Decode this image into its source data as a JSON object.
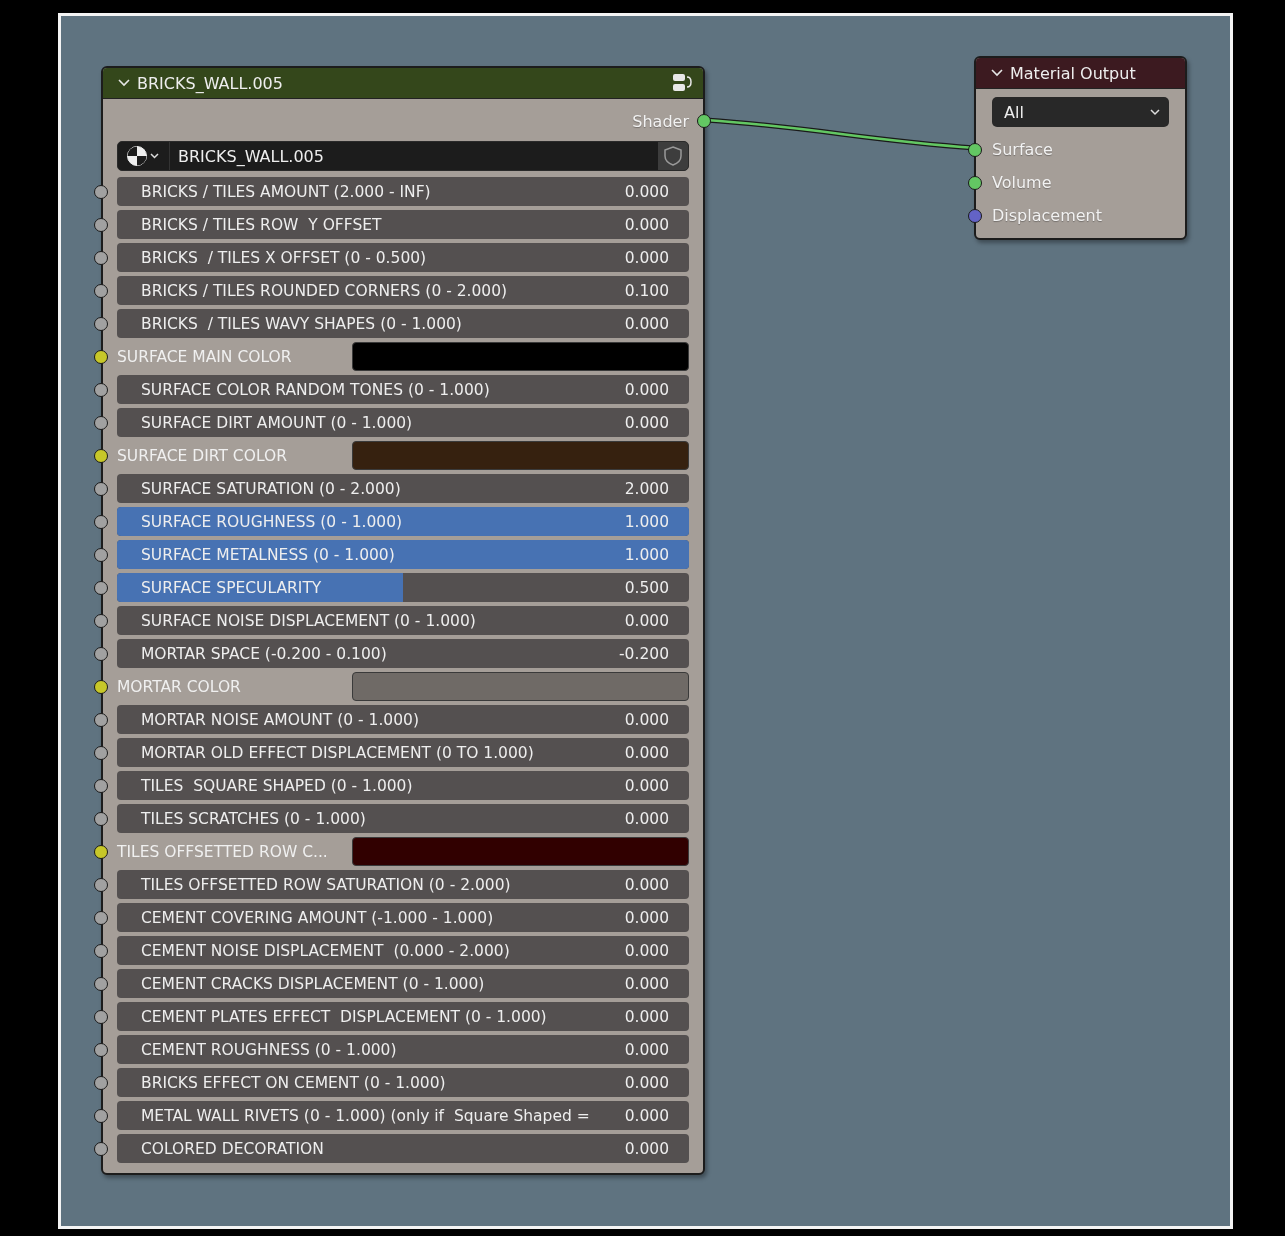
{
  "group_node": {
    "title": "BRICKS_WALL.005",
    "output": {
      "label": "Shader",
      "color": "#63c763"
    },
    "material": "BRICKS_WALL.005",
    "inputs": [
      {
        "kind": "number",
        "label": "BRICKS / TILES AMOUNT (2.000 - INF)",
        "value": "0.000"
      },
      {
        "kind": "number",
        "label": "BRICKS / TILES ROW  Y OFFSET",
        "value": "0.000"
      },
      {
        "kind": "number",
        "label": "BRICKS  / TILES X OFFSET (0 - 0.500)",
        "value": "0.000"
      },
      {
        "kind": "number",
        "label": "BRICKS / TILES ROUNDED CORNERS (0 - 2.000)",
        "value": "0.100"
      },
      {
        "kind": "number",
        "label": "BRICKS  / TILES WAVY SHAPES (0 - 1.000)",
        "value": "0.000"
      },
      {
        "kind": "color",
        "label": "SURFACE MAIN COLOR",
        "color": "#000000"
      },
      {
        "kind": "number",
        "label": "SURFACE COLOR RANDOM TONES (0 - 1.000)",
        "value": "0.000"
      },
      {
        "kind": "number",
        "label": "SURFACE DIRT AMOUNT (0 - 1.000)",
        "value": "0.000"
      },
      {
        "kind": "color",
        "label": "SURFACE DIRT COLOR",
        "color": "#36210f"
      },
      {
        "kind": "number",
        "label": "SURFACE SATURATION (0 - 2.000)",
        "value": "2.000"
      },
      {
        "kind": "slider",
        "label": "SURFACE ROUGHNESS (0 - 1.000)",
        "value": "1.000",
        "level": 1
      },
      {
        "kind": "slider",
        "label": "SURFACE METALNESS (0 - 1.000)",
        "value": "1.000",
        "level": 1
      },
      {
        "kind": "slider",
        "label": "SURFACE SPECULARITY",
        "value": "0.500",
        "level": 0.5
      },
      {
        "kind": "number",
        "label": "SURFACE NOISE DISPLACEMENT (0 - 1.000)",
        "value": "0.000"
      },
      {
        "kind": "number",
        "label": "MORTAR SPACE (-0.200 - 0.100)",
        "value": "-0.200"
      },
      {
        "kind": "color",
        "label": "MORTAR COLOR",
        "color": "#6f6a66"
      },
      {
        "kind": "number",
        "label": "MORTAR NOISE AMOUNT (0 - 1.000)",
        "value": "0.000"
      },
      {
        "kind": "number",
        "label": "MORTAR OLD EFFECT DISPLACEMENT (0 TO 1.000)",
        "value": "0.000"
      },
      {
        "kind": "number",
        "label": "TILES  SQUARE SHAPED (0 - 1.000)",
        "value": "0.000"
      },
      {
        "kind": "number",
        "label": "TILES SCRATCHES (0 - 1.000)",
        "value": "0.000"
      },
      {
        "kind": "color",
        "label": "TILES OFFSETTED ROW C...",
        "color": "#310000"
      },
      {
        "kind": "number",
        "label": "TILES OFFSETTED ROW SATURATION (0 - 2.000)",
        "value": "0.000"
      },
      {
        "kind": "number",
        "label": "CEMENT COVERING AMOUNT (-1.000 - 1.000)",
        "value": "0.000"
      },
      {
        "kind": "number",
        "label": "CEMENT NOISE DISPLACEMENT  (0.000 - 2.000)",
        "value": "0.000"
      },
      {
        "kind": "number",
        "label": "CEMENT CRACKS DISPLACEMENT (0 - 1.000)",
        "value": "0.000"
      },
      {
        "kind": "number",
        "label": "CEMENT PLATES EFFECT  DISPLACEMENT (0 - 1.000)",
        "value": "0.000"
      },
      {
        "kind": "number",
        "label": "CEMENT ROUGHNESS (0 - 1.000)",
        "value": "0.000"
      },
      {
        "kind": "number",
        "label": "BRICKS EFFECT ON CEMENT (0 - 1.000)",
        "value": "0.000"
      },
      {
        "kind": "number",
        "label": "METAL WALL RIVETS (0 - 1.000) (only if  Square Shaped =",
        "value": "0.000"
      },
      {
        "kind": "number",
        "label": "COLORED DECORATION",
        "value": "0.000"
      }
    ]
  },
  "output_node": {
    "title": "Material Output",
    "target": "All",
    "inputs": [
      {
        "label": "Surface",
        "color": "#63c763"
      },
      {
        "label": "Volume",
        "color": "#63c763"
      },
      {
        "label": "Displacement",
        "color": "#6363c7"
      }
    ]
  }
}
